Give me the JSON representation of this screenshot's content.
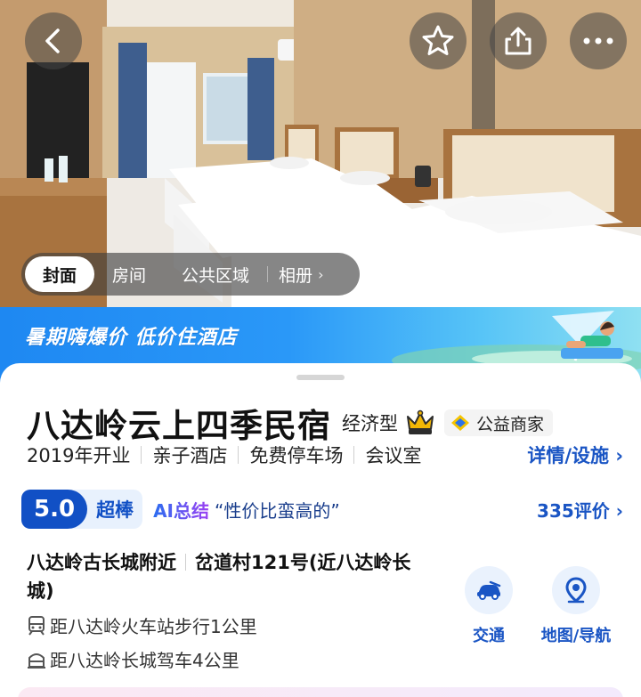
{
  "header": {
    "back_icon": "chevron-left-icon",
    "favorite_icon": "star-outline-icon",
    "share_icon": "share-icon",
    "more_icon": "ellipsis-icon"
  },
  "photo_tabs": [
    {
      "label": "封面",
      "active": true
    },
    {
      "label": "房间",
      "active": false
    },
    {
      "label": "公共区域",
      "active": false
    },
    {
      "label": "相册",
      "active": false
    }
  ],
  "promo": {
    "text": "暑期嗨爆价 低价住酒店"
  },
  "hotel": {
    "name": "八达岭云上四季民宿",
    "type": "经济型",
    "crown_icon": "crown-icon",
    "charity_label": "公益商家",
    "facilities": [
      "2019年开业",
      "亲子酒店",
      "免费停车场",
      "会议室"
    ],
    "details_link": "详情/设施"
  },
  "rating": {
    "score": "5.0",
    "word": "超棒",
    "ai_label": "AI总结",
    "ai_quote": "“性价比蛮高的”",
    "reviews": "335评价"
  },
  "location": {
    "area": "八达岭古长城附近",
    "address": "岔道村121号(近八达岭长城)",
    "distance_1": "距八达岭火车站步行1公里",
    "distance_2": "距八达岭长城驾车4公里"
  },
  "quick_actions": [
    {
      "label": "交通",
      "icon": "car-icon"
    },
    {
      "label": "地图/导航",
      "icon": "map-pin-icon"
    }
  ],
  "colors": {
    "primary_blue": "#1150c5",
    "link_blue": "#1a55c4",
    "promo_blue": "#1e88f2"
  }
}
